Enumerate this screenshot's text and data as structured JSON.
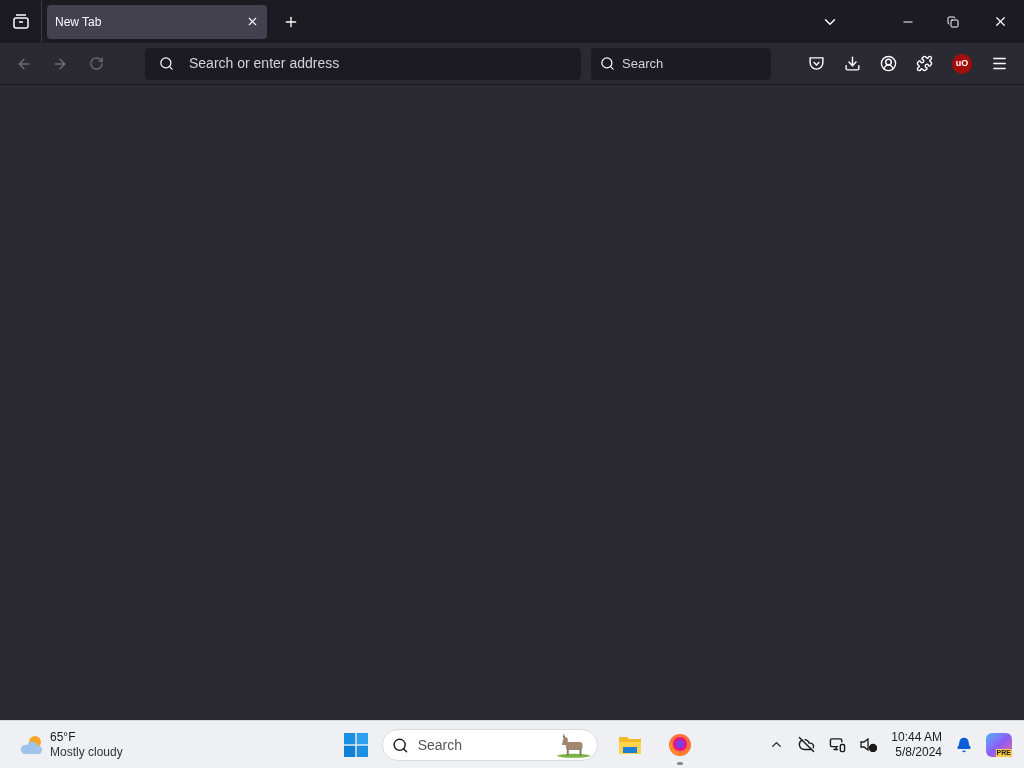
{
  "tabs": [
    {
      "title": "New Tab",
      "selected": true
    }
  ],
  "toolbar": {
    "back_disabled": true,
    "forward_disabled": true,
    "address": {
      "placeholder": "Search or enter address"
    },
    "search": {
      "placeholder": "Search"
    },
    "extension_badge": "uO"
  },
  "taskbar": {
    "weather": {
      "temperature": "65°F",
      "condition": "Mostly cloudy"
    },
    "search": {
      "placeholder": "Search"
    },
    "apps": [
      {
        "kind": "files",
        "running": false
      },
      {
        "kind": "firefox",
        "running": true
      }
    ],
    "clock": {
      "time": "10:44 AM",
      "date": "5/8/2024"
    },
    "copilot_badge": "PRE"
  }
}
